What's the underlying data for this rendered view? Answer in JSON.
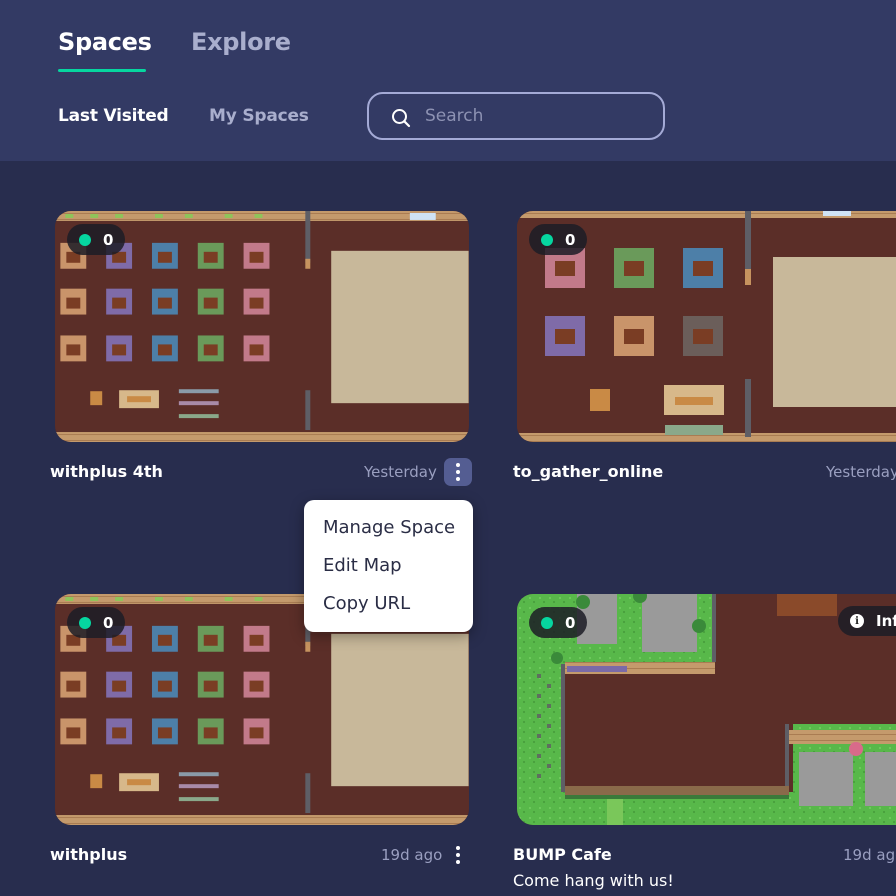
{
  "tabs": {
    "spaces": "Spaces",
    "explore": "Explore"
  },
  "subtabs": {
    "last_visited": "Last Visited",
    "my_spaces": "My Spaces"
  },
  "search": {
    "placeholder": "Search",
    "value": ""
  },
  "cards": [
    {
      "title": "withplus 4th",
      "time": "Yesterday",
      "online": "0"
    },
    {
      "title": "to_gather_online",
      "time": "Yesterday",
      "online": "0"
    },
    {
      "title": "withplus",
      "time": "19d ago",
      "online": "0"
    },
    {
      "title": "BUMP Cafe",
      "time": "19d ago",
      "online": "0",
      "description": "Come hang with us!",
      "info_label": "Info"
    }
  ],
  "context_menu": {
    "items": [
      "Manage Space",
      "Edit Map",
      "Copy URL"
    ]
  },
  "colors": {
    "header_bg": "#333a64",
    "page_bg": "#282d4e",
    "accent": "#06d6a0",
    "floor": "#5b2e28"
  }
}
